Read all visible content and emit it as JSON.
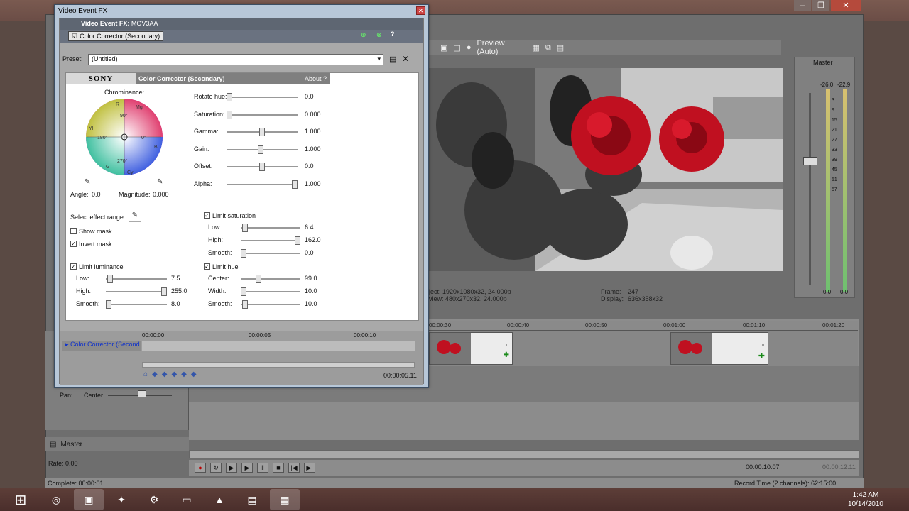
{
  "fx_window": {
    "title": "Video Event FX",
    "event_label": "Video Event FX:",
    "event_name": "MOV3AA",
    "effect_tab": "Color Corrector (Secondary)",
    "preset_label": "Preset:",
    "preset_value": "(Untitled)",
    "plugin_brand": "SONY",
    "plugin_name": "Color Corrector (Secondary)",
    "about": "About",
    "help": "?",
    "chrominance_label": "Chrominance:",
    "wheel_labels": [
      "R",
      "Mg",
      "90°",
      "Yl",
      "180°",
      "0°",
      "B",
      "G",
      "Cy",
      "270°"
    ],
    "angle_label": "Angle:",
    "angle_value": "0.0",
    "magnitude_label": "Magnitude:",
    "magnitude_value": "0.000",
    "params": [
      {
        "label": "Rotate hue:",
        "value": "0.0",
        "level": 0.0
      },
      {
        "label": "Saturation:",
        "value": "0.000",
        "level": 0.0
      },
      {
        "label": "Gamma:",
        "value": "1.000",
        "level": 0.5
      },
      {
        "label": "Gain:",
        "value": "1.000",
        "level": 0.48
      },
      {
        "label": "Offset:",
        "value": "0.0",
        "level": 0.5
      },
      {
        "label": "Alpha:",
        "value": "1.000",
        "level": 1.0
      }
    ],
    "select_range_label": "Select effect range:",
    "show_mask": "Show mask",
    "invert_mask": "Invert mask",
    "limit_luminance": "Limit luminance",
    "lum": [
      {
        "label": "Low:",
        "value": "7.5",
        "level": 0.03
      },
      {
        "label": "High:",
        "value": "255.0",
        "level": 1.0
      },
      {
        "label": "Smooth:",
        "value": "8.0",
        "level": 0.0
      }
    ],
    "limit_saturation": "Limit saturation",
    "sat": [
      {
        "label": "Low:",
        "value": "6.4",
        "level": 0.03
      },
      {
        "label": "High:",
        "value": "162.0",
        "level": 1.0
      },
      {
        "label": "Smooth:",
        "value": "0.0",
        "level": 0.0
      }
    ],
    "limit_hue": "Limit hue",
    "hue": [
      {
        "label": "Center:",
        "value": "99.0",
        "level": 0.27
      },
      {
        "label": "Width:",
        "value": "10.0",
        "level": 0.0
      },
      {
        "label": "Smooth:",
        "value": "10.0",
        "level": 0.02
      }
    ],
    "timeline_track": "Color Corrector (Second",
    "fx_ruler": [
      "00:00:00",
      "00:00:05",
      "00:00:10"
    ],
    "fx_time": "00:00:05.11"
  },
  "vegas": {
    "preview_label": "Preview (Auto)",
    "project_info": "ject:  1920x1080x32, 24.000p",
    "preview_info": "view:  480x270x32, 24.000p",
    "frame_label": "Frame:",
    "frame_value": "247",
    "display_label": "Display:",
    "display_value": "636x358x32",
    "master_label": "Master",
    "meter_left": "-26.0",
    "meter_right": "-22.9",
    "meter_scale": [
      "3",
      "9",
      "15",
      "21",
      "27",
      "33",
      "39",
      "45",
      "51",
      "57"
    ],
    "meter_bottom_left": "0.0",
    "meter_bottom_right": "0.0",
    "ruler_marks": [
      "00:00:30",
      "00:00:40",
      "00:00:50",
      "00:01:00",
      "00:01:10",
      "00:01:20"
    ],
    "pan_label": "Pan:",
    "pan_value": "Center",
    "master_bus": "Master",
    "rate_label": "Rate: 0.00",
    "time_display": "00:00:10.07",
    "time_display2": "00:00:12.11",
    "status_left": "Complete: 00:00:01",
    "status_right": "Record Time (2 channels): 62:15:00"
  },
  "taskbar": {
    "time": "1:42 AM",
    "date": "10/14/2010"
  }
}
